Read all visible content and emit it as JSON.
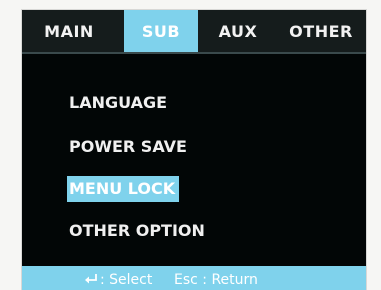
{
  "tabs": [
    {
      "label": "MAIN",
      "active": false
    },
    {
      "label": "SUB",
      "active": true
    },
    {
      "label": "AUX",
      "active": false
    },
    {
      "label": "OTHER",
      "active": false
    }
  ],
  "menu": {
    "items": [
      {
        "label": "LANGUAGE",
        "selected": false
      },
      {
        "label": "POWER SAVE",
        "selected": false
      },
      {
        "label": "MENU LOCK",
        "selected": true
      },
      {
        "label": "OTHER OPTION",
        "selected": false
      }
    ]
  },
  "status": {
    "select_icon": "enter-arrow-icon",
    "select_label": ": Select",
    "return_label": "Esc : Return"
  },
  "colors": {
    "accent": "#7fd2ec",
    "screen_background": "#020606",
    "tab_bar": "#151c1c",
    "text": "#f0f0f0"
  }
}
